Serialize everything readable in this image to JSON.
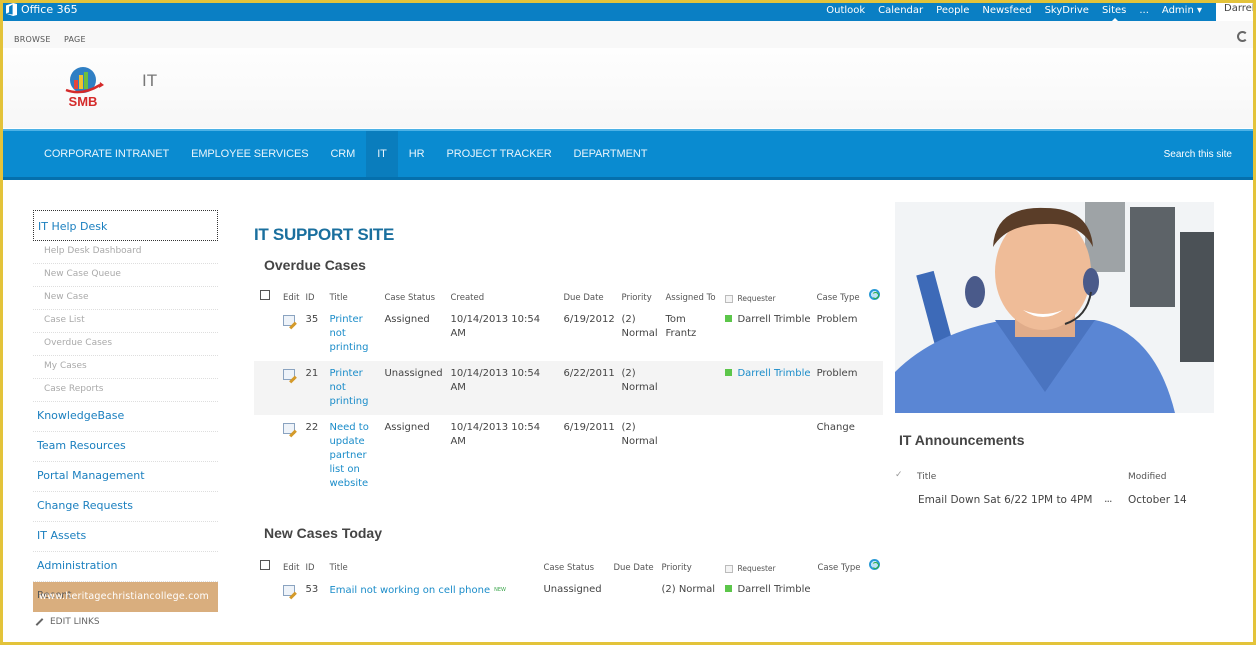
{
  "suite_bar": {
    "brand": "Office 365",
    "links": [
      "Outlook",
      "Calendar",
      "People",
      "Newsfeed",
      "SkyDrive",
      "Sites",
      "...",
      "Admin ▾"
    ],
    "active_link": "Sites",
    "user": "Darrell"
  },
  "ribbon": {
    "tabs": [
      "BROWSE",
      "PAGE"
    ]
  },
  "header": {
    "logo_text": "SMB",
    "site_title": "IT"
  },
  "topnav": {
    "items": [
      "CORPORATE INTRANET",
      "EMPLOYEE SERVICES",
      "CRM",
      "IT",
      "HR",
      "PROJECT TRACKER",
      "DEPARTMENT"
    ],
    "selected": "IT",
    "search_placeholder": "Search this site"
  },
  "leftnav": {
    "heading": "IT Help Desk",
    "sub_items": [
      "Help Desk Dashboard",
      "New Case Queue",
      "New Case",
      "Case List",
      "Overdue Cases",
      "My Cases",
      "Case Reports"
    ],
    "main_items": [
      "KnowledgeBase",
      "Team Resources",
      "Portal Management",
      "Change Requests",
      "IT Assets",
      "Administration"
    ],
    "recent": "Recent",
    "watermark": "www.heritagechristiancollege.com",
    "edit_links": "EDIT LINKS"
  },
  "main": {
    "page_heading": "IT SUPPORT SITE",
    "overdue": {
      "title": "Overdue Cases",
      "columns": [
        "Edit",
        "ID",
        "Title",
        "Case Status",
        "Created",
        "Due Date",
        "Priority",
        "Assigned To",
        "Requester",
        "Case Type"
      ],
      "rows": [
        {
          "id": "35",
          "title": "Printer not printing",
          "status": "Assigned",
          "created": "10/14/2013 10:54 AM",
          "due": "6/19/2012",
          "priority": "(2) Normal",
          "assigned_to": "Tom Frantz",
          "requester": "Darrell Trimble",
          "requester_link": false,
          "type": "Problem"
        },
        {
          "id": "21",
          "title": "Printer not printing",
          "status": "Unassigned",
          "created": "10/14/2013 10:54 AM",
          "due": "6/22/2011",
          "priority": "(2) Normal",
          "assigned_to": "",
          "requester": "Darrell Trimble",
          "requester_link": true,
          "type": "Problem"
        },
        {
          "id": "22",
          "title": "Need to update partner list on website",
          "status": "Assigned",
          "created": "10/14/2013 10:54 AM",
          "due": "6/19/2011",
          "priority": "(2) Normal",
          "assigned_to": "",
          "requester": "",
          "requester_link": false,
          "type": "Change"
        }
      ]
    },
    "new_today": {
      "title": "New Cases Today",
      "columns": [
        "Edit",
        "ID",
        "Title",
        "Case Status",
        "Due Date",
        "Priority",
        "Requester",
        "Case Type"
      ],
      "rows": [
        {
          "id": "53",
          "title": "Email not working on cell phone",
          "badge": "NEW",
          "status": "Unassigned",
          "due": "",
          "priority": "(2) Normal",
          "requester": "Darrell Trimble",
          "type": ""
        }
      ]
    }
  },
  "announcements": {
    "title": "IT Announcements",
    "columns": [
      "Title",
      "Modified"
    ],
    "items": [
      {
        "title": "Email Down Sat 6/22 1PM to 4PM",
        "menu": "...",
        "modified": "October 14"
      }
    ]
  },
  "colors": {
    "suite_bar": "#0a7fc4",
    "topnav": "#0a8bd0",
    "link": "#1a8cc9",
    "heading": "#1a6f9e",
    "presence_online": "#5cc64a",
    "recent_highlight": "#d9ae7e"
  }
}
